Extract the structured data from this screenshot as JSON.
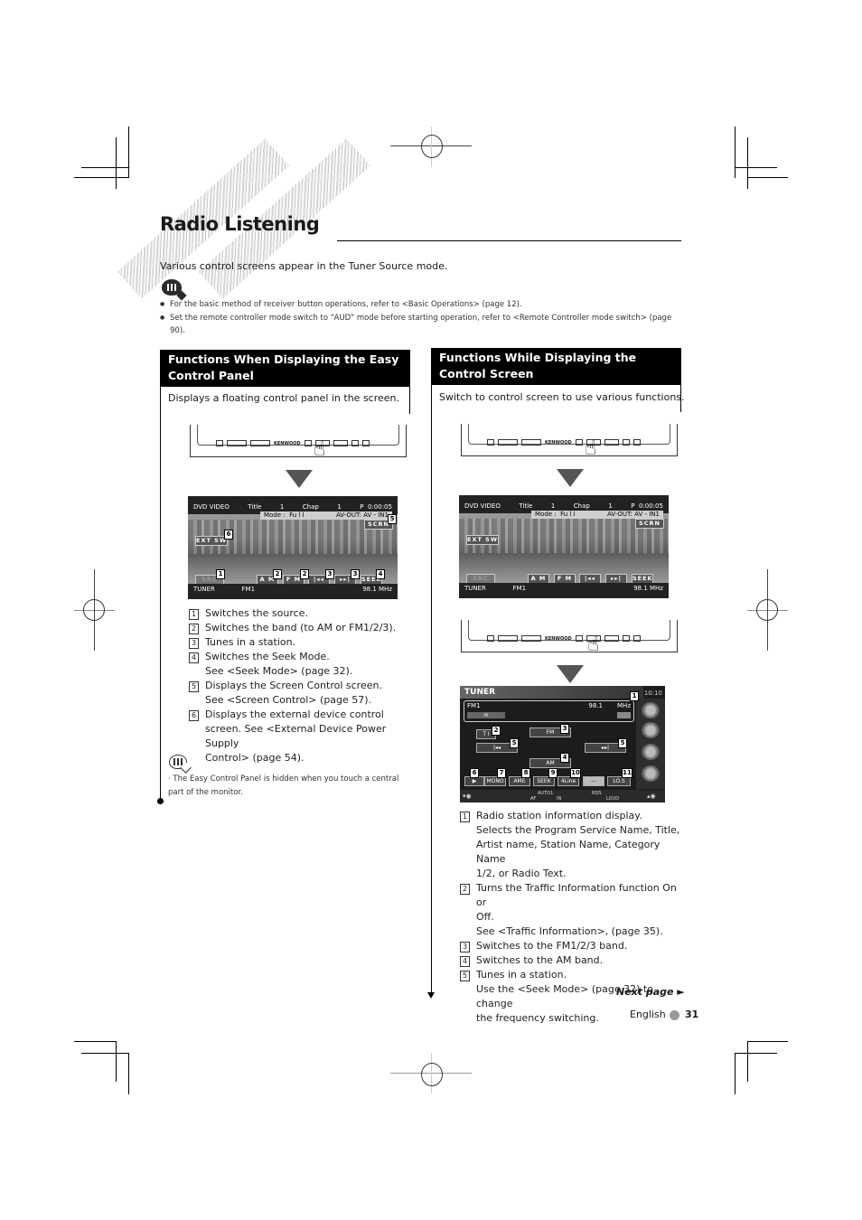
{
  "page": {
    "title": "Radio Listening",
    "intro": "Various control screens appear in the Tuner Source mode.",
    "notes": [
      "For the basic method of receiver button operations, refer to <Basic Operations> (page 12).",
      "Set the remote controller mode switch to \"AUD\" mode before starting operation, refer to <Remote Controller mode switch> (page 90)."
    ],
    "next_page": "Next page ►",
    "footer_language": "English",
    "page_number": "31"
  },
  "left_section": {
    "heading": "Functions When Displaying the Easy Control Panel",
    "description": "Displays a floating control panel in the screen.",
    "panel_brand": "KENWOOD",
    "screen": {
      "source": "DVD VIDEO",
      "title_label": "Title",
      "title_num": "1",
      "chap_label": "Chap",
      "chap_num": "1",
      "time": "P  0:00:05",
      "mode": "Mode :  Fu l l",
      "avout": "AV-OUT: AV - IN1",
      "buttons": {
        "scrn": "SCRN",
        "ext_sw": "EXT SW",
        "src": "SRC",
        "am": "A M",
        "fm": "F M",
        "prev": "|◂◂",
        "next": "▸▸|",
        "seek": "SEEK"
      },
      "bottom_source": "TUNER",
      "band": "FM1",
      "frequency": "98.1  MHz",
      "callouts": [
        "1",
        "2",
        "2",
        "3",
        "3",
        "4",
        "5",
        "6"
      ]
    },
    "items": [
      {
        "num": "1",
        "lines": [
          "Switches the source."
        ]
      },
      {
        "num": "2",
        "lines": [
          "Switches the band (to AM or FM1/2/3)."
        ]
      },
      {
        "num": "3",
        "lines": [
          "Tunes in a station."
        ]
      },
      {
        "num": "4",
        "lines": [
          "Switches the Seek Mode.",
          "See <Seek Mode> (page 32)."
        ]
      },
      {
        "num": "5",
        "lines": [
          "Displays the Screen Control screen.",
          "See <Screen Control> (page 57)."
        ]
      },
      {
        "num": "6",
        "lines": [
          "Displays the external device control",
          "screen. See <External Device Power Supply",
          "Control> (page 54)."
        ]
      }
    ],
    "note": "The Easy Control Panel is hidden when you touch a central part of the monitor."
  },
  "right_section": {
    "heading": "Functions While Displaying the Control Screen",
    "description": "Switch to control screen to use various functions.",
    "panel_brand": "KENWOOD",
    "screen": {
      "source": "DVD VIDEO",
      "title_label": "Title",
      "title_num": "1",
      "chap_label": "Chap",
      "chap_num": "1",
      "time": "P  0:00:05",
      "mode": "Mode :  Fu l l",
      "avout": "AV-OUT: AV - IN1",
      "buttons": {
        "scrn": "SCRN",
        "ext_sw": "EXT SW",
        "src": "SRC",
        "am": "A M",
        "fm": "F M",
        "prev": "|◂◂",
        "next": "▸▸|",
        "seek": "SEEK"
      },
      "bottom_source": "TUNER",
      "band": "FM1",
      "frequency": "98.1  MHz"
    },
    "tuner_screen": {
      "header": "TUNER",
      "clock": "10:10",
      "band": "FM1",
      "frequency": "98.1",
      "unit": "MHz",
      "ps_label": "PS",
      "buttons": {
        "ti": "T I",
        "fm": "FM",
        "prev": "|◂◂",
        "next": "▸▸|",
        "am": "AM",
        "play": "▶",
        "mono": "MONO",
        "ame": "AME",
        "seek": "SEEK",
        "line4": "4Line",
        "dash": "—",
        "los": "LO.S"
      },
      "status": {
        "auto": "AUTO1",
        "rds": "RDS",
        "af": "AF",
        "in": "IN",
        "loud": "LOUD"
      },
      "callouts": [
        "1",
        "2",
        "3",
        "5",
        "5",
        "4",
        "6",
        "7",
        "8",
        "9",
        "10",
        "11"
      ]
    },
    "items": [
      {
        "num": "1",
        "lines": [
          "Radio station information display.",
          "Selects the Program Service Name, Title,",
          "Artist name, Station Name, Category Name",
          "1/2, or Radio Text."
        ]
      },
      {
        "num": "2",
        "lines": [
          "Turns the Traffic Information function On or",
          "Off.",
          "See <Traffic Information>, (page 35)."
        ]
      },
      {
        "num": "3",
        "lines": [
          "Switches to the FM1/2/3 band."
        ]
      },
      {
        "num": "4",
        "lines": [
          "Switches to the AM band."
        ]
      },
      {
        "num": "5",
        "lines": [
          "Tunes in a station.",
          "Use the <Seek Mode> (page 32) to change",
          "the frequency switching."
        ]
      }
    ]
  }
}
